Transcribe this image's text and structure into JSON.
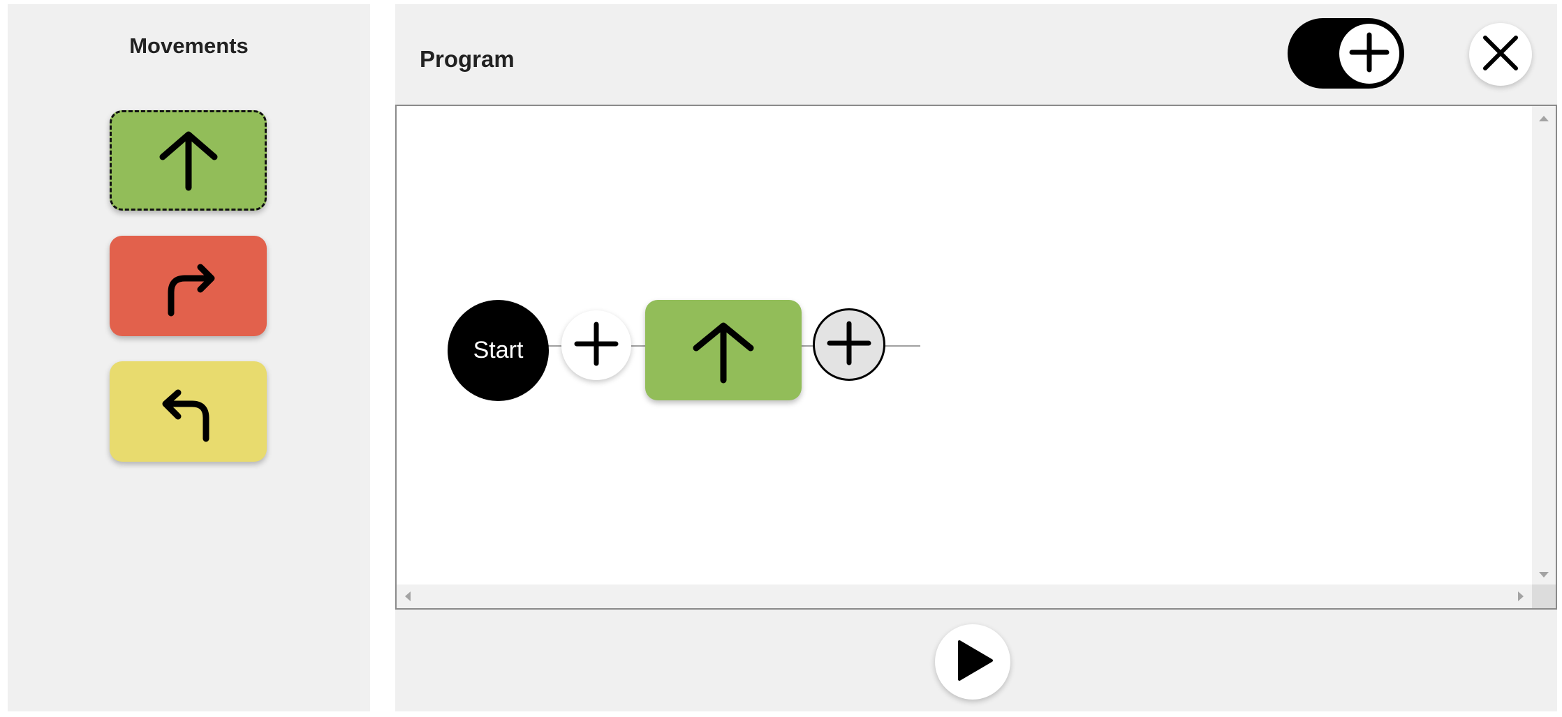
{
  "colors": {
    "panel_bg": "#f0f0f0",
    "forward": "#92bd59",
    "turn_right": "#e2614c",
    "turn_left": "#e8db6e",
    "dark": "#000000"
  },
  "movements": {
    "title": "Movements",
    "items": [
      {
        "name": "forward",
        "icon": "arrow-up-icon",
        "selected": true
      },
      {
        "name": "turn-right",
        "icon": "turn-right-arrow-icon",
        "selected": false
      },
      {
        "name": "turn-left",
        "icon": "turn-left-arrow-icon",
        "selected": false
      }
    ]
  },
  "program": {
    "title": "Program",
    "toggle": {
      "icon": "plus-circle-icon",
      "on": true
    },
    "close_icon": "close-icon",
    "start_label": "Start",
    "steps": [
      {
        "name": "forward",
        "icon": "arrow-up-icon"
      }
    ],
    "insert_icon": "plus-icon",
    "append_icon": "plus-icon",
    "play_icon": "play-icon"
  }
}
